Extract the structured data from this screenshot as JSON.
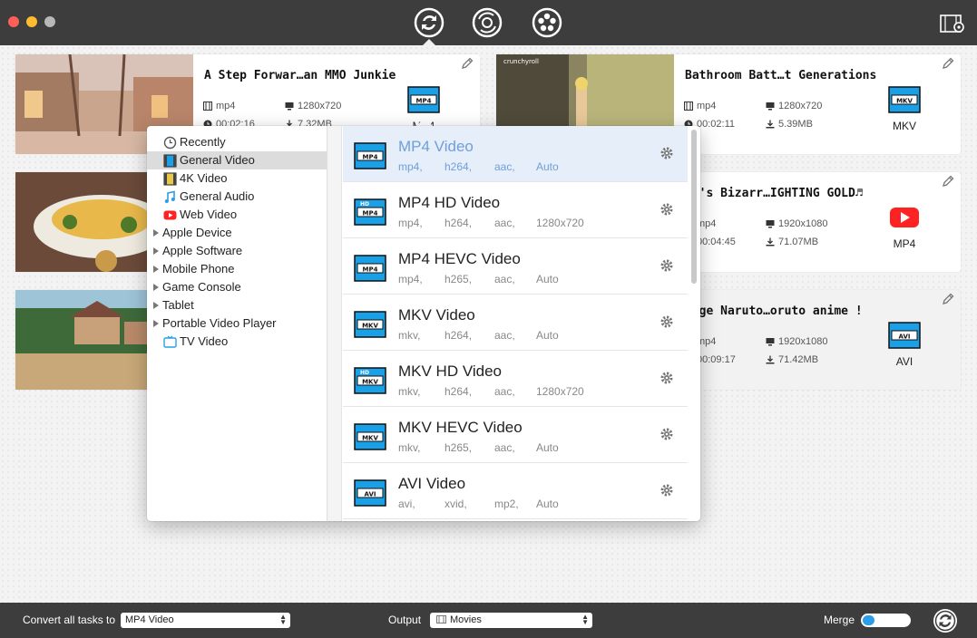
{
  "toolbar": {
    "buttons": [
      "convert-icon",
      "dvd-icon",
      "film-reel-icon"
    ],
    "right_icon": "film-settings-icon"
  },
  "cards": [
    {
      "title": "A Step Forwar…an MMO Junkie",
      "container": "mp4",
      "resolution": "1280x720",
      "duration": "00:02:16",
      "size": "7.32MB",
      "target": "MP4"
    },
    {
      "title": "Bathroom Batt…t Generations",
      "container": "mp4",
      "resolution": "1280x720",
      "duration": "00:02:11",
      "size": "5.39MB",
      "target": "MKV",
      "watermark": "crunchyroll"
    },
    {
      "title": "Jo's Bizarr…IGHTING GOLD♬",
      "container": "mp4",
      "resolution": "1920x1080",
      "duration": "00:04:45",
      "size": "71.07MB",
      "target": "MP4"
    },
    {
      "title": "kage Naruto…oruto anime !",
      "container": "mp4",
      "resolution": "1920x1080",
      "duration": "00:09:17",
      "size": "71.42MB",
      "target": "AVI"
    }
  ],
  "categories": [
    {
      "label": "Recently",
      "icon": "clock-icon"
    },
    {
      "label": "General Video",
      "icon": "film-icon",
      "selected": true
    },
    {
      "label": "4K Video",
      "icon": "4k-film-icon"
    },
    {
      "label": "General Audio",
      "icon": "music-note-icon"
    },
    {
      "label": "Web Video",
      "icon": "youtube-icon"
    },
    {
      "label": "Apple Device",
      "group": true
    },
    {
      "label": "Apple Software",
      "group": true
    },
    {
      "label": "Mobile Phone",
      "group": true
    },
    {
      "label": "Game Console",
      "group": true
    },
    {
      "label": "Tablet",
      "group": true
    },
    {
      "label": "Portable Video Player",
      "group": true
    },
    {
      "label": "TV Video",
      "icon": "tv-icon"
    }
  ],
  "formats": [
    {
      "name": "MP4 Video",
      "badge": "MP4",
      "hd": false,
      "specs": [
        "mp4,",
        "h264,",
        "aac,",
        "Auto"
      ],
      "selected": true
    },
    {
      "name": "MP4 HD Video",
      "badge": "MP4",
      "hd": true,
      "specs": [
        "mp4,",
        "h264,",
        "aac,",
        "1280x720"
      ]
    },
    {
      "name": "MP4 HEVC Video",
      "badge": "MP4",
      "hd": false,
      "specs": [
        "mp4,",
        "h265,",
        "aac,",
        "Auto"
      ]
    },
    {
      "name": "MKV Video",
      "badge": "MKV",
      "hd": false,
      "specs": [
        "mkv,",
        "h264,",
        "aac,",
        "Auto"
      ]
    },
    {
      "name": "MKV HD Video",
      "badge": "MKV",
      "hd": true,
      "specs": [
        "mkv,",
        "h264,",
        "aac,",
        "1280x720"
      ]
    },
    {
      "name": "MKV HEVC Video",
      "badge": "MKV",
      "hd": false,
      "specs": [
        "mkv,",
        "h265,",
        "aac,",
        "Auto"
      ]
    },
    {
      "name": "AVI Video",
      "badge": "AVI",
      "hd": false,
      "specs": [
        "avi,",
        "xvid,",
        "mp2,",
        "Auto"
      ]
    }
  ],
  "bottom": {
    "convert_label": "Convert all tasks to",
    "convert_value": "MP4 Video",
    "output_label": "Output",
    "output_value": "Movies",
    "merge_label": "Merge"
  },
  "colors": {
    "chrome": "#3d3d3d",
    "selection": "#6f9fd8",
    "badge_blue": "#1aa0e6",
    "merge_toggle": "#2a9ee8"
  }
}
